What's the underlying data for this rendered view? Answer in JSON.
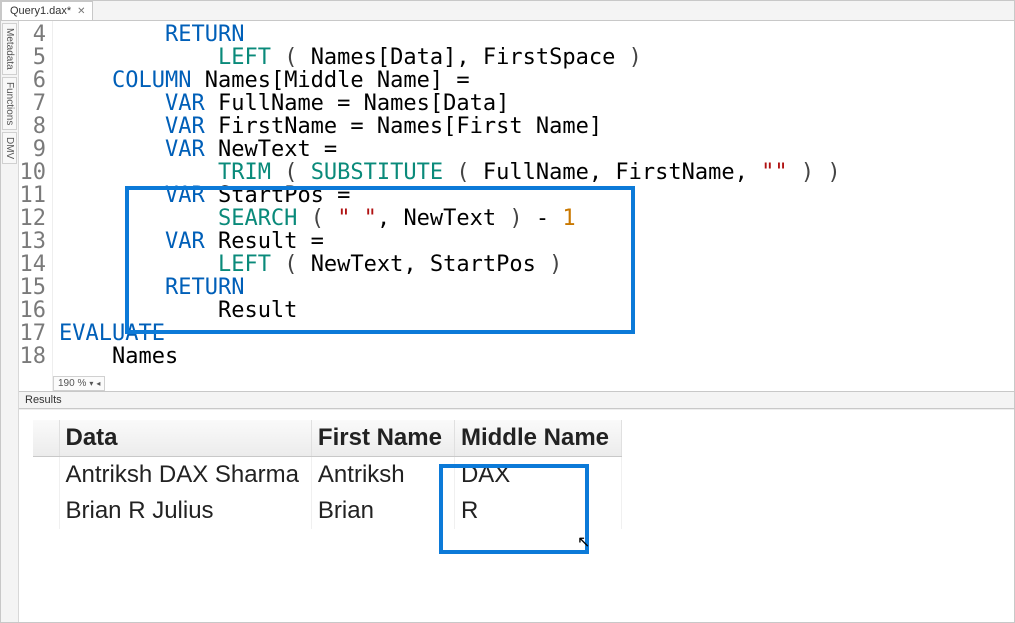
{
  "tab": {
    "title": "Query1.dax*"
  },
  "rail": {
    "metadata": "Metadata",
    "functions": "Functions",
    "dmv": "DMV"
  },
  "editor": {
    "zoom_label": "190 %",
    "lines": {
      "l4": {
        "n": "4"
      },
      "l5": {
        "n": "5"
      },
      "l6": {
        "n": "6"
      },
      "l7": {
        "n": "7"
      },
      "l8": {
        "n": "8"
      },
      "l9": {
        "n": "9"
      },
      "l10": {
        "n": "10"
      },
      "l11": {
        "n": "11"
      },
      "l12": {
        "n": "12"
      },
      "l13": {
        "n": "13"
      },
      "l14": {
        "n": "14"
      },
      "l15": {
        "n": "15"
      },
      "l16": {
        "n": "16"
      },
      "l17": {
        "n": "17"
      },
      "l18": {
        "n": "18"
      }
    },
    "tokens": {
      "RETURN": "RETURN",
      "VAR": "VAR",
      "COLUMN": "COLUMN",
      "EVALUATE": "EVALUATE",
      "LEFT": "LEFT",
      "TRIM": "TRIM",
      "SUBSTITUTE": "SUBSTITUTE",
      "SEARCH": "SEARCH",
      "NamesData": "Names[Data]",
      "FirstSpace": "FirstSpace",
      "MiddleNameHdr": "Names[Middle Name] =",
      "FullNameDecl": "FullName = Names[Data]",
      "FirstNameDecl": "FirstName = Names[First Name]",
      "NewTextDecl": "NewText =",
      "FullName": "FullName",
      "FirstName": "FirstName",
      "emptystr": "\"\"",
      "StartPosDecl": "StartPos =",
      "spacelit": "\" \"",
      "NewText": "NewText",
      "minus1": "1",
      "ResultDecl": "Result =",
      "StartPos": "StartPos",
      "Result": "Result",
      "Names": "Names",
      "comma": ",",
      "lparen": "(",
      "rparen": ")",
      "minus": " - "
    }
  },
  "results": {
    "panel_title": "Results",
    "columns": [
      "Data",
      "First Name",
      "Middle Name"
    ],
    "rows": [
      {
        "data": "Antriksh DAX Sharma",
        "first": "Antriksh",
        "middle": "DAX"
      },
      {
        "data": "Brian R Julius",
        "first": "Brian",
        "middle": "R"
      }
    ]
  }
}
